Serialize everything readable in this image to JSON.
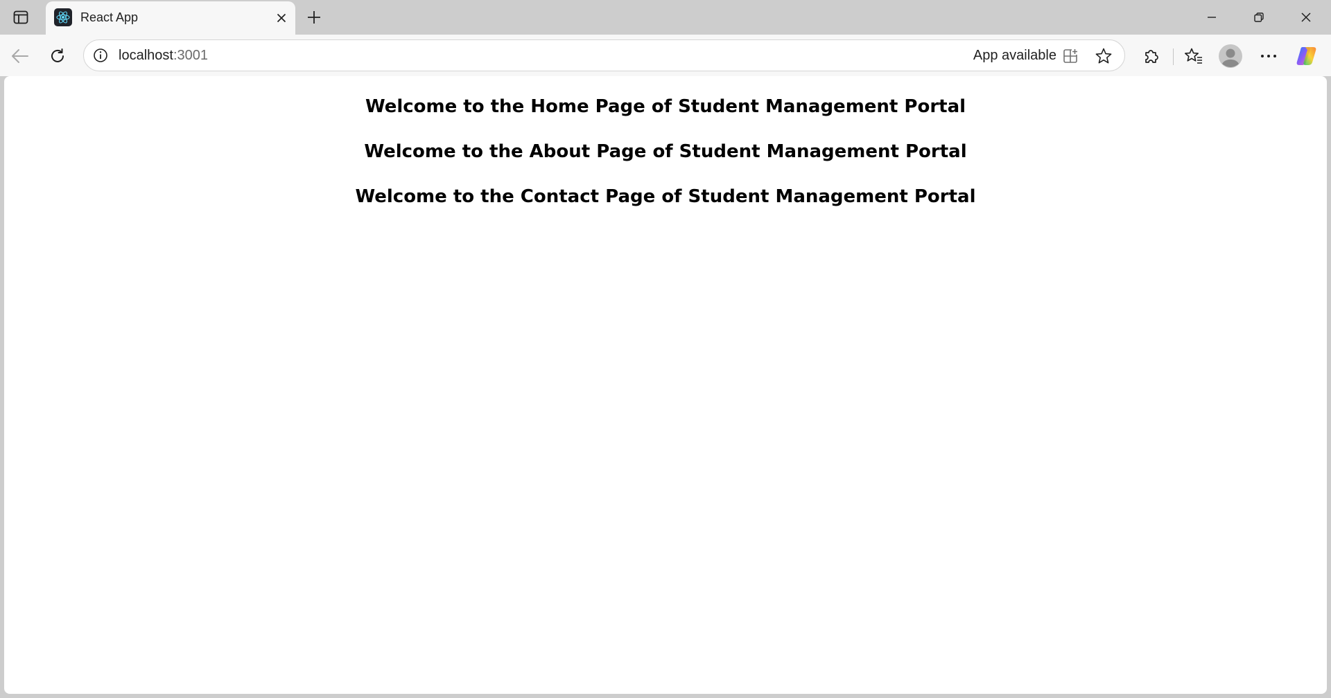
{
  "browser": {
    "tab": {
      "title": "React App",
      "favicon": "react-logo-icon"
    },
    "address_bar": {
      "host": "localhost",
      "port": ":3001",
      "app_available_label": "App available"
    },
    "icons": {
      "sidebar": "sidebar-toggle-icon",
      "close_tab": "close-icon",
      "new_tab": "plus-icon",
      "back": "back-arrow-icon",
      "refresh": "refresh-icon",
      "site_info": "info-icon",
      "app_install": "app-install-icon",
      "favorite": "star-icon",
      "extensions": "puzzle-icon",
      "favorites": "favorites-icon",
      "profile": "avatar-icon",
      "more": "more-dots-icon",
      "copilot": "copilot-icon"
    },
    "colors": {
      "tabstrip_bg": "#cdcdcd",
      "toolbar_bg": "#f7f7f7",
      "react_blue": "#61dafb"
    }
  },
  "page": {
    "headings": [
      "Welcome to the Home Page of Student Management Portal",
      "Welcome to the About Page of Student Management Portal",
      "Welcome to the Contact Page of Student Management Portal"
    ]
  }
}
